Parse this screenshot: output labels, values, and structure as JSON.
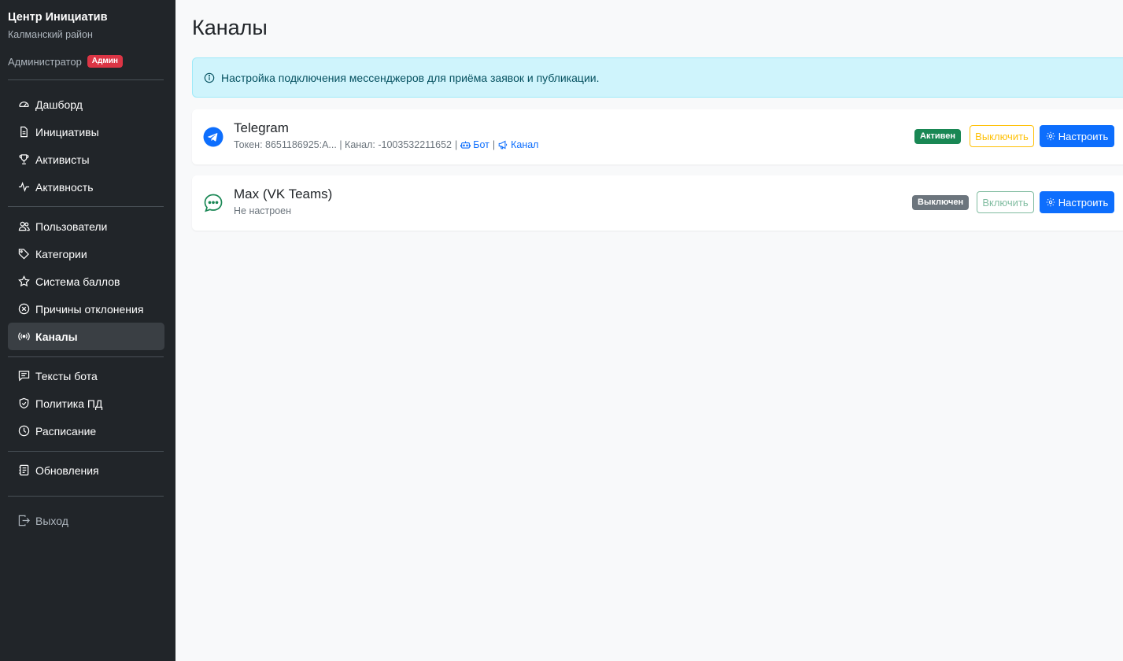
{
  "brand": {
    "title": "Центр Инициатив",
    "subtitle": "Калманский район"
  },
  "user": {
    "role": "Администратор",
    "badge": "Админ"
  },
  "nav": {
    "dashboard": "Дашборд",
    "initiatives": "Инициативы",
    "activists": "Активисты",
    "activity": "Активность",
    "users": "Пользователи",
    "categories": "Категории",
    "points": "Система баллов",
    "reject_reasons": "Причины отклонения",
    "channels": "Каналы",
    "bot_texts": "Тексты бота",
    "policy": "Политика ПД",
    "schedule": "Расписание",
    "updates": "Обновления",
    "logout": "Выход"
  },
  "page": {
    "title": "Каналы"
  },
  "alert": {
    "text": "Настройка подключения мессенджеров для приёма заявок и публикации."
  },
  "channels": [
    {
      "name": "Telegram",
      "token_text": "Токен: 8651186925:A... | Канал: -1003532211652",
      "bot_link": "Бот",
      "channel_link": "Канал",
      "status": "Активен",
      "toggle_label": "Выключить",
      "config_label": "Настроить"
    },
    {
      "name": "Max (VK Teams)",
      "subtitle": "Не настроен",
      "status": "Выключен",
      "toggle_label": "Включить",
      "config_label": "Настроить"
    }
  ],
  "colors": {
    "sidebar_bg": "#212529",
    "active_badge": "#198754",
    "inactive_badge": "#6c757d",
    "primary": "#0d6efd",
    "warning": "#ffc107",
    "alert_bg": "#cff4fc"
  }
}
